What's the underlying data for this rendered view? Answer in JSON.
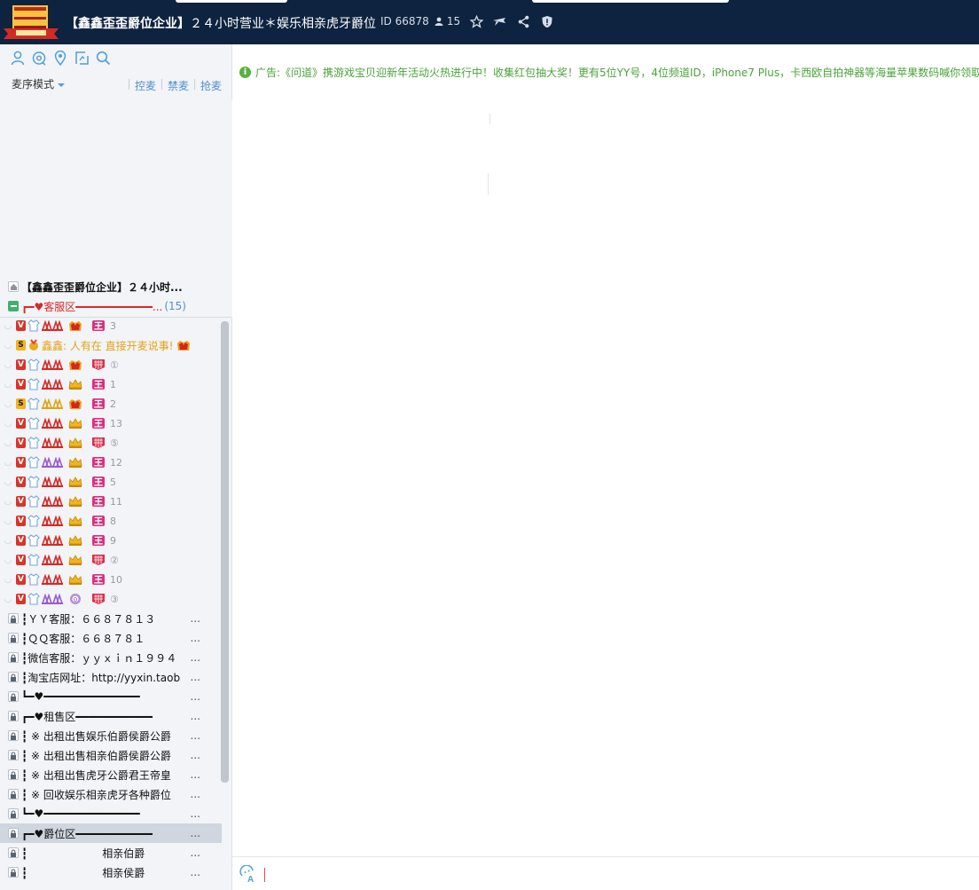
{
  "header": {
    "title_main": "【鑫鑫歪歪爵位企业】",
    "title_rest": "２４小时营业＊娱乐相亲虎牙爵位",
    "id_label": "ID",
    "channel_id": "66878",
    "online_count": "15",
    "icons": [
      "user-icon",
      "star-icon",
      "plane-icon",
      "share-icon",
      "shield-icon"
    ]
  },
  "toolbar": {
    "icons": [
      "member-icon",
      "settings-icon",
      "location-icon",
      "screen-icon",
      "search-icon"
    ],
    "mic_mode": "麦序模式",
    "controls": [
      "控麦",
      "禁麦",
      "抢麦"
    ]
  },
  "channel_tree": {
    "root": "【鑫鑫歪歪爵位企业】２４小时...",
    "group_service": "┏━♥客服区━━━━━━━━━━━━...",
    "group_service_count": "(15)",
    "members": [
      {
        "badge": "V",
        "crown": "red",
        "tag": "王",
        "num": "3"
      },
      {
        "badge": "S",
        "text": "鑫鑫: 人有在 直接开麦说事!",
        "crown": "red"
      },
      {
        "badge": "V",
        "crown": "red",
        "tag": "grid",
        "num": "①"
      },
      {
        "badge": "V",
        "crown": "gold",
        "tag": "王",
        "num": "1"
      },
      {
        "badge": "S",
        "crown": "red",
        "tag": "王",
        "num": "2"
      },
      {
        "badge": "V",
        "crown": "gold",
        "tag": "王",
        "num": "13"
      },
      {
        "badge": "V",
        "crown": "gold",
        "tag": "grid",
        "num": "⑤"
      },
      {
        "badge": "V",
        "crown": "gold",
        "tag": "王",
        "num": "12"
      },
      {
        "badge": "V",
        "crown": "gold",
        "tag": "王",
        "num": "5"
      },
      {
        "badge": "V",
        "crown": "gold",
        "tag": "王",
        "num": "11"
      },
      {
        "badge": "V",
        "crown": "gold",
        "tag": "王",
        "num": "8"
      },
      {
        "badge": "V",
        "crown": "gold",
        "tag": "王",
        "num": "9"
      },
      {
        "badge": "V",
        "crown": "gold",
        "tag": "grid",
        "num": "②"
      },
      {
        "badge": "V",
        "crown": "gold",
        "tag": "王",
        "num": "10"
      },
      {
        "badge": "V",
        "crown": "purple",
        "tag": "grid",
        "num": "③"
      }
    ],
    "channels": [
      {
        "text": "┇ＹＹ客服：６６８７８１３",
        "dots": "..."
      },
      {
        "text": "┇ＱＱ客服：６６８７８１",
        "dots": "..."
      },
      {
        "text": "┇微信客服：ｙｙｘｉｎ１９９４",
        "dots": "..."
      },
      {
        "text": "┇淘宝店网址：http://yyxin.taob",
        "dots": "..."
      },
      {
        "text": "┗━♥━━━━━━━━━━━━━━━",
        "dots": "..."
      },
      {
        "text": "┏━♥租售区━━━━━━━━━━━━",
        "dots": "..."
      },
      {
        "text": "┇ ※ 出租出售娱乐伯爵侯爵公爵",
        "dots": "..."
      },
      {
        "text": "┇ ※ 出租出售相亲伯爵侯爵公爵",
        "dots": "..."
      },
      {
        "text": "┇ ※ 出租出售虎牙公爵君王帝皇",
        "dots": "..."
      },
      {
        "text": "┇ ※ 回收娱乐相亲虎牙各种爵位",
        "dots": "..."
      },
      {
        "text": "┗━♥━━━━━━━━━━━━━━━",
        "dots": "..."
      },
      {
        "text": "┏━♥爵位区━━━━━━━━━━━━",
        "dots": "..."
      },
      {
        "text": "┇　　　　　　　相亲伯爵",
        "dots": "..."
      },
      {
        "text": "┇　　　　　　　相亲侯爵",
        "dots": "..."
      }
    ]
  },
  "main": {
    "ad_text": "广告:《问道》携游戏宝贝迎新年活动火热进行中！收集红包抽大奖！更有5位YY号，4位频道ID，iPhone7 Plus，卡西欧自拍神器等海量苹果数码喊你领取啦"
  },
  "colors": {
    "header_bg": "#0e2340",
    "panel_bg": "#f2f4f7",
    "ad_green": "#4aa33a",
    "group_red": "#d42a26",
    "link_blue": "#4f8fd0"
  }
}
